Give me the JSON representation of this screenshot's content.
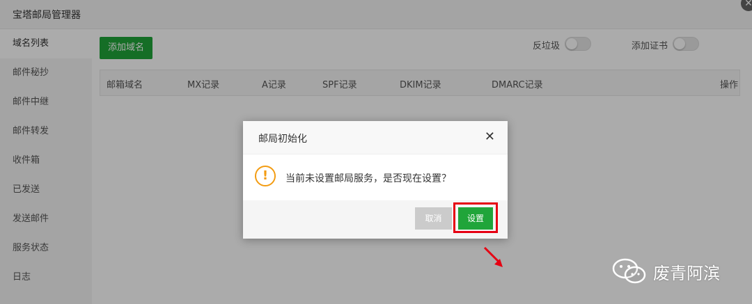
{
  "app": {
    "title": "宝塔邮局管理器",
    "close_symbol": "✕"
  },
  "sidebar": {
    "items": [
      {
        "label": "域名列表"
      },
      {
        "label": "邮件秘抄"
      },
      {
        "label": "邮件中继"
      },
      {
        "label": "邮件转发"
      },
      {
        "label": "收件箱"
      },
      {
        "label": "已发送"
      },
      {
        "label": "发送邮件"
      },
      {
        "label": "服务状态"
      },
      {
        "label": "日志"
      }
    ]
  },
  "toolbar": {
    "add_domain_label": "添加域名",
    "antispam_label": "反垃圾",
    "add_cert_label": "添加证书"
  },
  "table": {
    "headers": [
      "邮箱域名",
      "MX记录",
      "A记录",
      "SPF记录",
      "DKIM记录",
      "DMARC记录",
      "操作"
    ]
  },
  "dialog": {
    "title": "邮局初始化",
    "close_symbol": "✕",
    "warning_symbol": "!",
    "message": "当前未设置邮局服务，是否现在设置？",
    "cancel_label": "取消",
    "confirm_label": "设置"
  },
  "watermark": {
    "text": "废青阿滨"
  },
  "colors": {
    "primary_green": "#20a53a",
    "warning_orange": "#f39c12",
    "highlight_red": "#e60012"
  }
}
